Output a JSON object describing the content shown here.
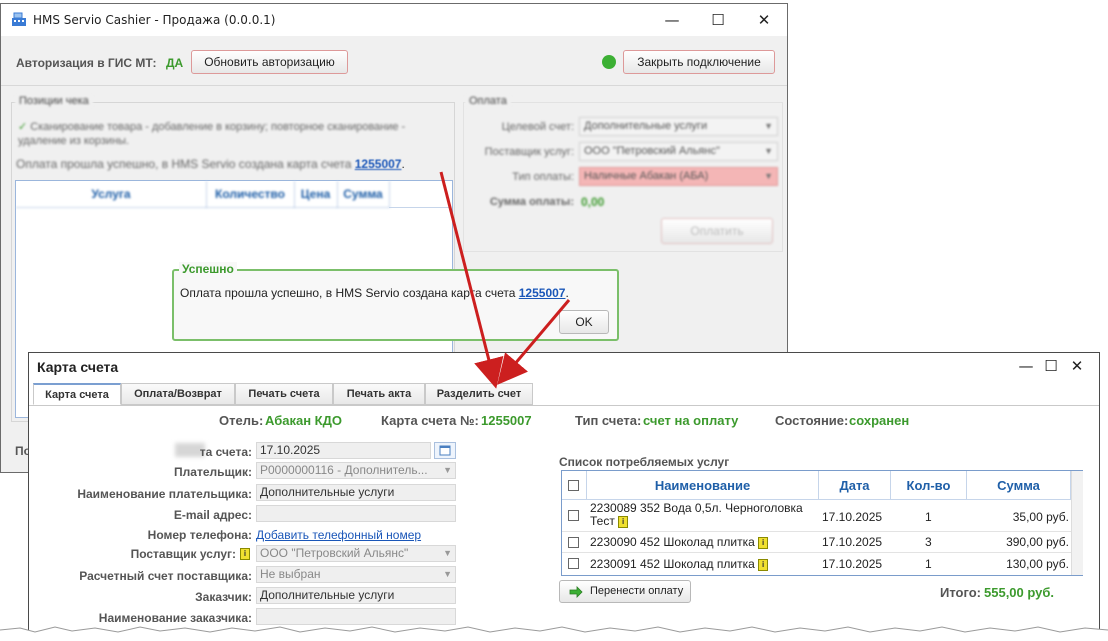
{
  "back_window": {
    "title": "HMS Servio Cashier - Продажа (0.0.0.1)",
    "auth_label": "Авторизация в ГИС МТ:",
    "auth_value": "ДА",
    "refresh_auth_button": "Обновить авторизацию",
    "close_connection_button": "Закрыть подключение",
    "status_color": "#3cb034",
    "positions": {
      "legend": "Позиции чека",
      "hint": "Сканирование товара - добавление в корзину; повторное сканирование - удаление из корзины.",
      "success_text": "Оплата прошла успешно, в HMS Servio создана карта счета",
      "account_number": "1255007",
      "columns": [
        "Услуга",
        "Количество",
        "Цена",
        "Сумма"
      ]
    },
    "payment": {
      "legend": "Оплата",
      "target_account_label": "Целевой счет:",
      "target_account_value": "Дополнительные услуги",
      "supplier_label": "Поставщик услуг:",
      "supplier_value": "ООО \"Петровский Альянс\"",
      "payment_type_label": "Тип оплаты:",
      "payment_type_value": "Наличные Абакан (АБА)",
      "amount_label": "Сумма оплаты:",
      "amount_value": "0,00",
      "pay_button": "Оплатить"
    },
    "bottom_label": "По"
  },
  "popup": {
    "title": "Успешно",
    "message": "Оплата прошла успешно, в HMS Servio создана карта счета",
    "account_number": "1255007",
    "ok_button": "OK"
  },
  "front_window": {
    "title": "Карта счета",
    "tabs": [
      "Карта счета",
      "Оплата/Возврат",
      "Печать счета",
      "Печать акта",
      "Разделить счет"
    ],
    "hotel_label": "Отель:",
    "hotel_value": "Абакан КДО",
    "account_label": "Карта счета №:",
    "account_value": "1255007",
    "type_label": "Тип счета:",
    "type_value": "счет на оплату",
    "state_label": "Состояние:",
    "state_value": "сохранен",
    "form": {
      "date_label": "та счета:",
      "date_value": "17.10.2025",
      "payer_label": "Плательщик:",
      "payer_value": "P0000000116 - Дополнитель...",
      "payer_name_label": "Наименование плательщика:",
      "payer_name_value": "Дополнительные услуги",
      "email_label": "E-mail адрес:",
      "email_value": "",
      "phone_label": "Номер телефона:",
      "phone_link": "Добавить телефонный номер",
      "supplier_label": "Поставщик услуг:",
      "supplier_value": "ООО \"Петровский Альянс\"",
      "supplier_account_label": "Расчетный счет поставщика:",
      "supplier_account_value": "Не выбран",
      "customer_label": "Заказчик:",
      "customer_value": "Дополнительные услуги",
      "customer_name_label": "Наименование заказчика:"
    },
    "services": {
      "title": "Список потребляемых услуг",
      "columns": [
        "Наименование",
        "Дата",
        "Кол-во",
        "Сумма"
      ],
      "rows": [
        {
          "name": "2230089 352 Вода 0,5л. Черноголовка Тест",
          "date": "17.10.2025",
          "qty": "1",
          "sum": "35,00 руб."
        },
        {
          "name": "2230090 452 Шоколад плитка",
          "date": "17.10.2025",
          "qty": "3",
          "sum": "390,00 руб."
        },
        {
          "name": "2230091 452 Шоколад плитка",
          "date": "17.10.2025",
          "qty": "1",
          "sum": "130,00 руб."
        }
      ],
      "transfer_button": "Перенести оплату",
      "total_label": "Итого:",
      "total_value": "555,00 руб."
    }
  },
  "colors": {
    "accent_green": "#3c9a2d",
    "link_blue": "#1a56b8",
    "header_blue": "#1f5fa8",
    "arrow_red": "#cc1f1f",
    "payment_type_bg": "#f4b6b6"
  }
}
